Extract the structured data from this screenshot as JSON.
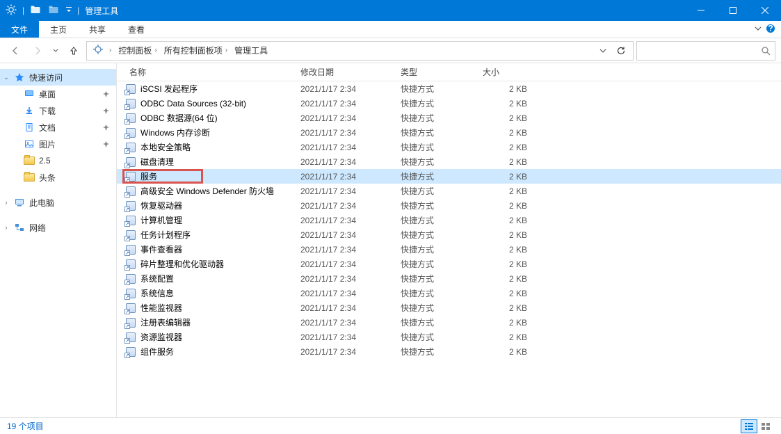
{
  "titlebar": {
    "title": "管理工具",
    "divider": "|"
  },
  "ribbon": {
    "file": "文件",
    "tabs": [
      "主页",
      "共享",
      "查看"
    ]
  },
  "breadcrumb": {
    "items": [
      "控制面板",
      "所有控制面板项",
      "管理工具"
    ]
  },
  "search": {
    "placeholder": ""
  },
  "nav": {
    "quick_access": "快速访问",
    "items": [
      {
        "label": "桌面",
        "icon": "desktop",
        "pinned": true
      },
      {
        "label": "下载",
        "icon": "downloads",
        "pinned": true
      },
      {
        "label": "文档",
        "icon": "documents",
        "pinned": true
      },
      {
        "label": "图片",
        "icon": "pictures",
        "pinned": true
      },
      {
        "label": "2.5",
        "icon": "folder",
        "pinned": false
      },
      {
        "label": "头条",
        "icon": "folder",
        "pinned": false
      }
    ],
    "this_pc": "此电脑",
    "network": "网络"
  },
  "columns": {
    "name": "名称",
    "date": "修改日期",
    "type": "类型",
    "size": "大小"
  },
  "files": [
    {
      "name": "iSCSI 发起程序",
      "date": "2021/1/17 2:34",
      "type": "快捷方式",
      "size": "2 KB"
    },
    {
      "name": "ODBC Data Sources (32-bit)",
      "date": "2021/1/17 2:34",
      "type": "快捷方式",
      "size": "2 KB"
    },
    {
      "name": "ODBC 数据源(64 位)",
      "date": "2021/1/17 2:34",
      "type": "快捷方式",
      "size": "2 KB"
    },
    {
      "name": "Windows 内存诊断",
      "date": "2021/1/17 2:34",
      "type": "快捷方式",
      "size": "2 KB"
    },
    {
      "name": "本地安全策略",
      "date": "2021/1/17 2:34",
      "type": "快捷方式",
      "size": "2 KB"
    },
    {
      "name": "磁盘清理",
      "date": "2021/1/17 2:34",
      "type": "快捷方式",
      "size": "2 KB"
    },
    {
      "name": "服务",
      "date": "2021/1/17 2:34",
      "type": "快捷方式",
      "size": "2 KB",
      "highlighted": true,
      "active": true
    },
    {
      "name": "高级安全 Windows Defender 防火墙",
      "date": "2021/1/17 2:34",
      "type": "快捷方式",
      "size": "2 KB"
    },
    {
      "name": "恢复驱动器",
      "date": "2021/1/17 2:34",
      "type": "快捷方式",
      "size": "2 KB"
    },
    {
      "name": "计算机管理",
      "date": "2021/1/17 2:34",
      "type": "快捷方式",
      "size": "2 KB"
    },
    {
      "name": "任务计划程序",
      "date": "2021/1/17 2:34",
      "type": "快捷方式",
      "size": "2 KB"
    },
    {
      "name": "事件查看器",
      "date": "2021/1/17 2:34",
      "type": "快捷方式",
      "size": "2 KB"
    },
    {
      "name": "碎片整理和优化驱动器",
      "date": "2021/1/17 2:34",
      "type": "快捷方式",
      "size": "2 KB"
    },
    {
      "name": "系统配置",
      "date": "2021/1/17 2:34",
      "type": "快捷方式",
      "size": "2 KB"
    },
    {
      "name": "系统信息",
      "date": "2021/1/17 2:34",
      "type": "快捷方式",
      "size": "2 KB"
    },
    {
      "name": "性能监视器",
      "date": "2021/1/17 2:34",
      "type": "快捷方式",
      "size": "2 KB"
    },
    {
      "name": "注册表编辑器",
      "date": "2021/1/17 2:34",
      "type": "快捷方式",
      "size": "2 KB"
    },
    {
      "name": "资源监视器",
      "date": "2021/1/17 2:34",
      "type": "快捷方式",
      "size": "2 KB"
    },
    {
      "name": "组件服务",
      "date": "2021/1/17 2:34",
      "type": "快捷方式",
      "size": "2 KB"
    }
  ],
  "status": {
    "count": "19 个项目"
  }
}
